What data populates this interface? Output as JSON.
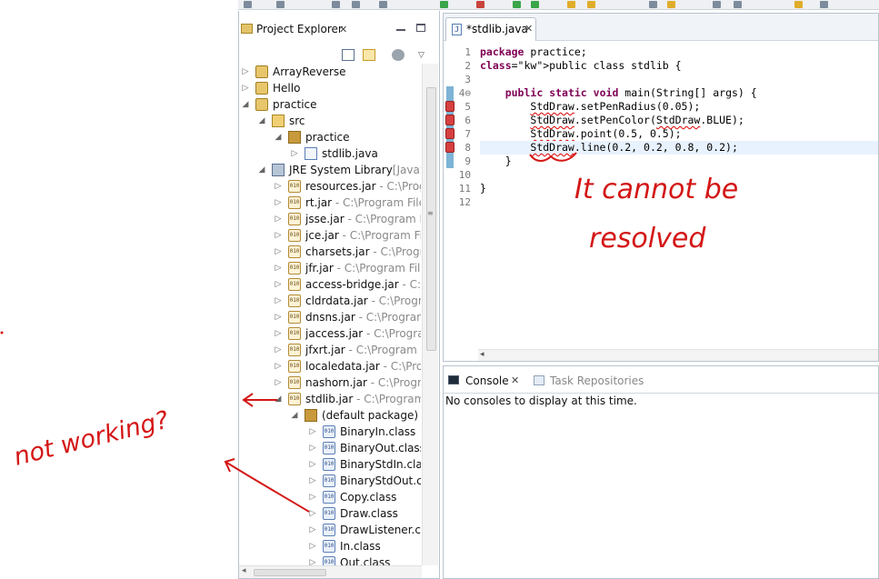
{
  "colors": {
    "accent": "#7f0055",
    "annotation": "#d41616",
    "error_marker": "#d64040",
    "selection": "#e8f2fe"
  },
  "project_explorer": {
    "title": "Project Explorer",
    "close_glyph": "✕",
    "icons": [
      "collapse-all-icon",
      "link-with-editor-icon",
      "filter-icon",
      "view-menu-icon"
    ],
    "tree": [
      {
        "label": "ArrayReverse",
        "sub": "",
        "icon": "project-icon",
        "twisty": "▷"
      },
      {
        "label": "Hello",
        "sub": "",
        "icon": "project-icon",
        "twisty": "▷"
      },
      {
        "label": "practice",
        "sub": "",
        "icon": "project-icon",
        "twisty": "◢"
      },
      {
        "label": "src",
        "sub": "",
        "icon": "source-folder-icon",
        "twisty": "◢"
      },
      {
        "label": "practice",
        "sub": "",
        "icon": "package-icon",
        "twisty": "◢"
      },
      {
        "label": "stdlib.java",
        "sub": "",
        "icon": "java-file-icon",
        "twisty": "▷"
      },
      {
        "label": "JRE System Library",
        "sub": "[JavaSE-",
        "icon": "library-icon",
        "twisty": "◢"
      },
      {
        "label": "resources.jar",
        "sub": " - C:\\Progr",
        "icon": "jar-icon",
        "twisty": "▷"
      },
      {
        "label": "rt.jar",
        "sub": " - C:\\Program Files",
        "icon": "jar-icon",
        "twisty": "▷"
      },
      {
        "label": "jsse.jar",
        "sub": " - C:\\Program Fil",
        "icon": "jar-icon",
        "twisty": "▷"
      },
      {
        "label": "jce.jar",
        "sub": " - C:\\Program File",
        "icon": "jar-icon",
        "twisty": "▷"
      },
      {
        "label": "charsets.jar",
        "sub": " - C:\\Progra",
        "icon": "jar-icon",
        "twisty": "▷"
      },
      {
        "label": "jfr.jar",
        "sub": " - C:\\Program File",
        "icon": "jar-icon",
        "twisty": "▷"
      },
      {
        "label": "access-bridge.jar",
        "sub": " - C:\\P",
        "icon": "jar-icon",
        "twisty": "▷"
      },
      {
        "label": "cldrdata.jar",
        "sub": " - C:\\Progra",
        "icon": "jar-icon",
        "twisty": "▷"
      },
      {
        "label": "dnsns.jar",
        "sub": " - C:\\Program",
        "icon": "jar-icon",
        "twisty": "▷"
      },
      {
        "label": "jaccess.jar",
        "sub": " - C:\\Progran",
        "icon": "jar-icon",
        "twisty": "▷"
      },
      {
        "label": "jfxrt.jar",
        "sub": " - C:\\Program Fi",
        "icon": "jar-icon",
        "twisty": "▷"
      },
      {
        "label": "localedata.jar",
        "sub": " - C:\\Prog",
        "icon": "jar-icon",
        "twisty": "▷"
      },
      {
        "label": "nashorn.jar",
        "sub": " - C:\\Progra",
        "icon": "jar-icon",
        "twisty": "▷"
      },
      {
        "label": "stdlib.jar",
        "sub": " - C:\\Program",
        "icon": "jar-icon",
        "twisty": "◢"
      },
      {
        "label": "(default package)",
        "sub": "",
        "icon": "package-icon",
        "twisty": "◢"
      },
      {
        "label": "BinaryIn.class",
        "sub": "",
        "icon": "class-file-icon",
        "twisty": "▷"
      },
      {
        "label": "BinaryOut.class",
        "sub": "",
        "icon": "class-file-icon",
        "twisty": "▷"
      },
      {
        "label": "BinaryStdIn.clas",
        "sub": "",
        "icon": "class-file-icon",
        "twisty": "▷"
      },
      {
        "label": "BinaryStdOut.cla",
        "sub": "",
        "icon": "class-file-icon",
        "twisty": "▷"
      },
      {
        "label": "Copy.class",
        "sub": "",
        "icon": "class-file-icon",
        "twisty": "▷"
      },
      {
        "label": "Draw.class",
        "sub": "",
        "icon": "class-file-icon",
        "twisty": "▷"
      },
      {
        "label": "DrawListener.cla",
        "sub": "",
        "icon": "class-file-icon",
        "twisty": "▷"
      },
      {
        "label": "In.class",
        "sub": "",
        "icon": "class-file-icon",
        "twisty": "▷"
      },
      {
        "label": "Out.class",
        "sub": "",
        "icon": "class-file-icon",
        "twisty": "▷"
      }
    ]
  },
  "editor": {
    "tab_label": "*stdlib.java",
    "tab_close": "✕",
    "lines": [
      {
        "n": "1",
        "code": "package practice;",
        "kw": "package",
        "error": false
      },
      {
        "n": "2",
        "code": "public class stdlib {",
        "kw": "public class",
        "error": false
      },
      {
        "n": "3",
        "code": "",
        "kw": "",
        "error": false
      },
      {
        "n": "4⊖",
        "code": "    public static void main(String[] args) {",
        "kw": "public static void",
        "error": false
      },
      {
        "n": "5",
        "code": "        StdDraw.setPenRadius(0.05);",
        "kw": "",
        "error": true
      },
      {
        "n": "6",
        "code": "        StdDraw.setPenColor(StdDraw.BLUE);",
        "kw": "",
        "error": true
      },
      {
        "n": "7",
        "code": "        StdDraw.point(0.5, 0.5);",
        "kw": "",
        "error": true
      },
      {
        "n": "8",
        "code": "        StdDraw.line(0.2, 0.2, 0.8, 0.2);",
        "kw": "",
        "error": true
      },
      {
        "n": "9",
        "code": "    }",
        "kw": "",
        "error": false
      },
      {
        "n": "10",
        "code": "",
        "kw": "",
        "error": false
      },
      {
        "n": "11",
        "code": "}",
        "kw": "",
        "error": false
      },
      {
        "n": "12",
        "code": "",
        "kw": "",
        "error": false
      }
    ]
  },
  "console": {
    "tab_label": "Console",
    "tab_close": "✕",
    "other_tab": "Task Repositories",
    "message": "No consoles to display at this time."
  },
  "annotations": {
    "resolve_line1": "It cannot be",
    "resolve_line2": "resolved",
    "not_working": "not working?"
  }
}
